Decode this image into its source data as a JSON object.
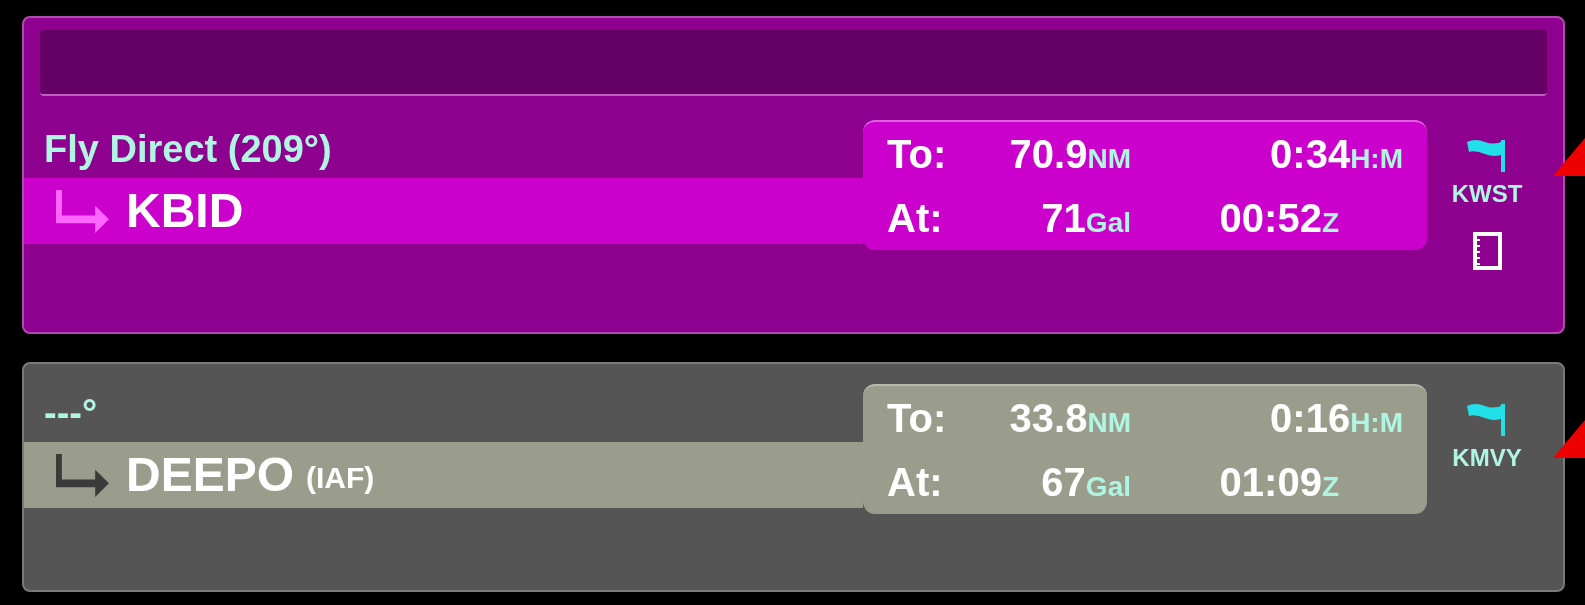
{
  "panels": [
    {
      "active": true,
      "course": "Fly Direct (209°)",
      "waypoint": "KBID",
      "to_label": "To:",
      "distance": "70.9",
      "distance_unit": "NM",
      "ete": "0:34",
      "ete_unit": "H:M",
      "at_label": "At:",
      "fuel": "71",
      "fuel_unit": "Gal",
      "eta": "00:52",
      "eta_unit": "Z",
      "airport": "KWST",
      "notes": true
    },
    {
      "active": false,
      "course": "---°",
      "waypoint": "DEEPO",
      "waypoint_note": "(IAF)",
      "to_label": "To:",
      "distance": "33.8",
      "distance_unit": "NM",
      "ete": "0:16",
      "ete_unit": "H:M",
      "at_label": "At:",
      "fuel": "67",
      "fuel_unit": "Gal",
      "eta": "01:09",
      "eta_unit": "Z",
      "airport": "KMVY",
      "notes": false
    }
  ]
}
